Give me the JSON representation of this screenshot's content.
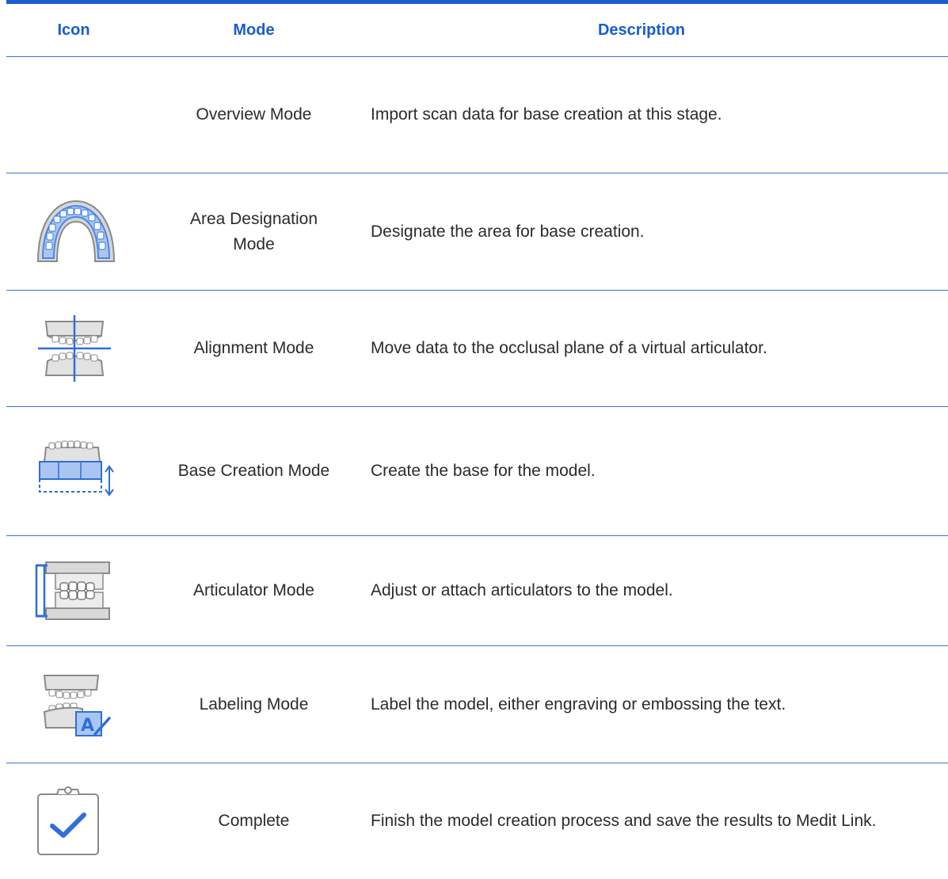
{
  "header": {
    "icon": "Icon",
    "mode": "Mode",
    "description": "Description"
  },
  "rows": [
    {
      "icon": "none",
      "mode": "Overview Mode",
      "description": "Import scan data for base creation at this stage."
    },
    {
      "icon": "arch-area-icon",
      "mode": "Area Designation Mode",
      "description": "Designate the area for base creation."
    },
    {
      "icon": "alignment-crosshair-icon",
      "mode": "Alignment Mode",
      "description": "Move data to the occlusal plane of a virtual articulator."
    },
    {
      "icon": "base-creation-icon",
      "mode": "Base Creation Mode",
      "description": "Create the base for the model."
    },
    {
      "icon": "articulator-icon",
      "mode": "Articulator Mode",
      "description": "Adjust or attach articulators to the model."
    },
    {
      "icon": "labeling-icon",
      "mode": "Labeling Mode",
      "description": "Label the model, either engraving or embossing the text."
    },
    {
      "icon": "clipboard-check-icon",
      "mode": "Complete",
      "description": "Finish the model creation process and save the results to Medit Link."
    }
  ],
  "colors": {
    "accent": "#1a5ccf",
    "rule": "#3b73d6",
    "icon_blue": "#4a86e8",
    "icon_gray": "#8a8a8a"
  }
}
